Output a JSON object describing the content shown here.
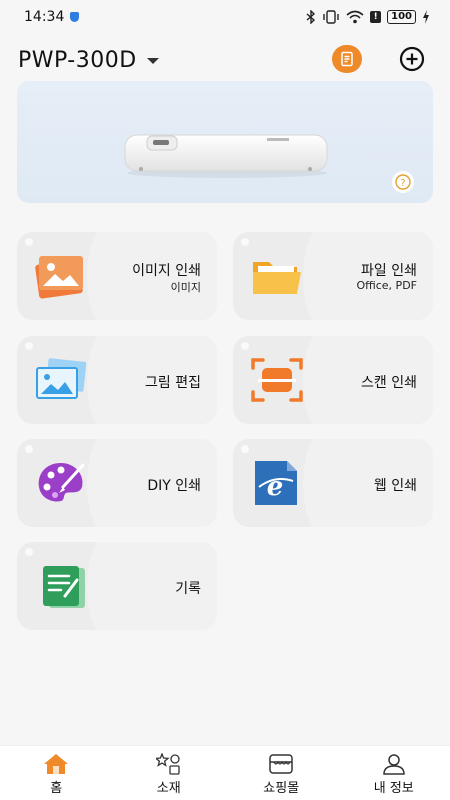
{
  "status_bar": {
    "time": "14:34",
    "battery": "100"
  },
  "header": {
    "device_name": "PWP-300D"
  },
  "colors": {
    "accent": "#ef8a2a",
    "card": "#ececec",
    "web_blue": "#2d6fb8",
    "diy_purple": "#9b3fc9",
    "note_green": "#2f9e5a"
  },
  "cards": [
    {
      "label": "이미지 인쇄",
      "sub": "이미지",
      "icon": "image-stack-icon"
    },
    {
      "label": "파일 인쇄",
      "sub": "Office, PDF",
      "icon": "folder-icon"
    },
    {
      "label": "그림 편집",
      "sub": "",
      "icon": "photo-edit-icon"
    },
    {
      "label": "스캔 인쇄",
      "sub": "",
      "icon": "scan-icon"
    },
    {
      "label": "DIY 인쇄",
      "sub": "",
      "icon": "palette-icon"
    },
    {
      "label": "웹 인쇄",
      "sub": "",
      "icon": "web-icon"
    },
    {
      "label": "기록",
      "sub": "",
      "icon": "note-icon"
    }
  ],
  "nav": [
    {
      "label": "홈",
      "icon": "home-icon"
    },
    {
      "label": "소재",
      "icon": "materials-icon"
    },
    {
      "label": "쇼핑몰",
      "icon": "shop-icon"
    },
    {
      "label": "내 정보",
      "icon": "profile-icon"
    }
  ]
}
